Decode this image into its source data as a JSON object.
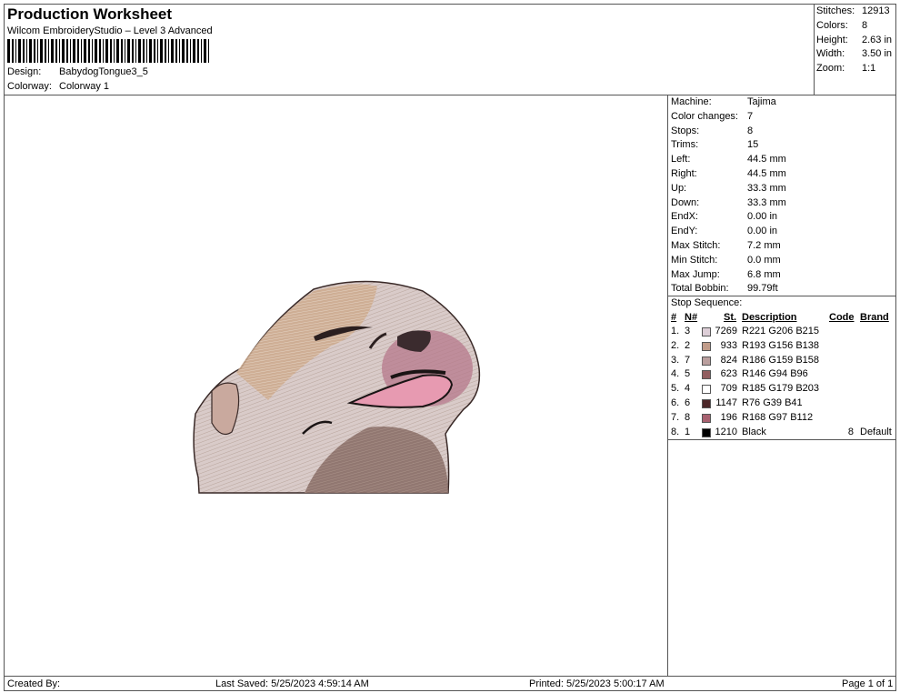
{
  "header": {
    "title": "Production Worksheet",
    "subtitle": "Wilcom EmbroideryStudio – Level 3 Advanced",
    "design_label": "Design:",
    "design_value": "BabydogTongue3_5",
    "colorway_label": "Colorway:",
    "colorway_value": "Colorway 1"
  },
  "stats": [
    {
      "label": "Stitches:",
      "value": "12913"
    },
    {
      "label": "Colors:",
      "value": "8"
    },
    {
      "label": "Height:",
      "value": "2.63 in"
    },
    {
      "label": "Width:",
      "value": "3.50 in"
    },
    {
      "label": "Zoom:",
      "value": "1:1"
    }
  ],
  "machine_props": [
    {
      "label": "Machine:",
      "value": "Tajima"
    },
    {
      "label": "Color changes:",
      "value": "7"
    },
    {
      "label": "Stops:",
      "value": "8"
    },
    {
      "label": "Trims:",
      "value": "15"
    },
    {
      "label": "Left:",
      "value": "44.5 mm"
    },
    {
      "label": "Right:",
      "value": "44.5 mm"
    },
    {
      "label": "Up:",
      "value": "33.3 mm"
    },
    {
      "label": "Down:",
      "value": "33.3 mm"
    },
    {
      "label": "EndX:",
      "value": "0.00 in"
    },
    {
      "label": "EndY:",
      "value": "0.00 in"
    },
    {
      "label": "Max Stitch:",
      "value": "7.2 mm"
    },
    {
      "label": "Min Stitch:",
      "value": "0.0 mm"
    },
    {
      "label": "Max Jump:",
      "value": "6.8 mm"
    },
    {
      "label": "Total Bobbin:",
      "value": "99.79ft"
    }
  ],
  "stop_sequence": {
    "title": "Stop Sequence:",
    "headers": {
      "num": "#",
      "n": "N#",
      "st": "St.",
      "desc": "Description",
      "code": "Code",
      "brand": "Brand"
    },
    "rows": [
      {
        "num": "1.",
        "n": "3",
        "color": "#DDCED7",
        "st": "7269",
        "desc": "R221 G206 B215",
        "code": "",
        "brand": ""
      },
      {
        "num": "2.",
        "n": "2",
        "color": "#C19C8A",
        "st": "933",
        "desc": "R193 G156 B138",
        "code": "",
        "brand": ""
      },
      {
        "num": "3.",
        "n": "7",
        "color": "#BA9F9E",
        "st": "824",
        "desc": "R186 G159 B158",
        "code": "",
        "brand": ""
      },
      {
        "num": "4.",
        "n": "5",
        "color": "#925E60",
        "st": "623",
        "desc": "R146 G94 B96",
        "code": "",
        "brand": ""
      },
      {
        "num": "5.",
        "n": "4",
        "color": "#FFFFFF",
        "st": "709",
        "desc": "R185 G179 B203",
        "code": "",
        "brand": ""
      },
      {
        "num": "6.",
        "n": "6",
        "color": "#4C2729",
        "st": "1147",
        "desc": "R76 G39 B41",
        "code": "",
        "brand": ""
      },
      {
        "num": "7.",
        "n": "8",
        "color": "#A86170",
        "st": "196",
        "desc": "R168 G97 B112",
        "code": "",
        "brand": ""
      },
      {
        "num": "8.",
        "n": "1",
        "color": "#000000",
        "st": "1210",
        "desc": "Black",
        "code": "8",
        "brand": "Default"
      }
    ]
  },
  "footer": {
    "created_by": "Created By:",
    "last_saved": "Last Saved: 5/25/2023 4:59:14 AM",
    "printed": "Printed: 5/25/2023 5:00:17 AM",
    "page": "Page 1 of 1"
  }
}
